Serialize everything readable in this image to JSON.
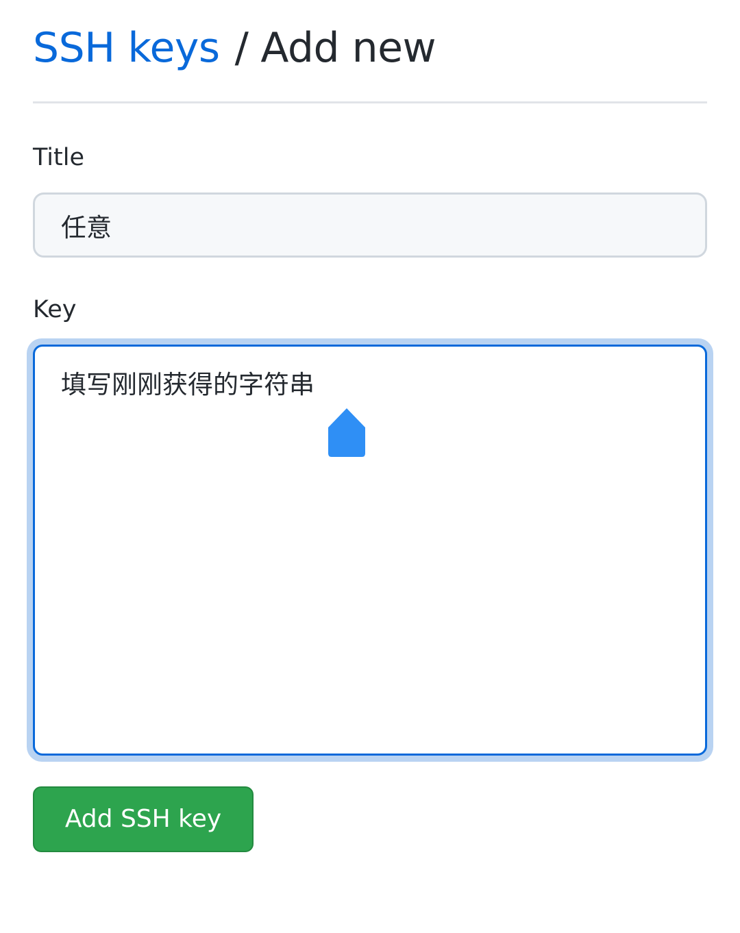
{
  "header": {
    "parent_link": "SSH keys",
    "separator": "/",
    "current": "Add new"
  },
  "form": {
    "title_label": "Title",
    "title_value": "任意",
    "key_label": "Key",
    "key_value": "填写刚刚获得的字符串",
    "submit_label": "Add SSH key"
  },
  "colors": {
    "link": "#0969da",
    "focus_border": "#0969da",
    "focus_ring": "#b9d3f2",
    "submit_bg": "#2da44e",
    "handle": "#2f8ff5"
  },
  "icons": {
    "text_selection_handle": "text-cursor-handle-icon"
  }
}
